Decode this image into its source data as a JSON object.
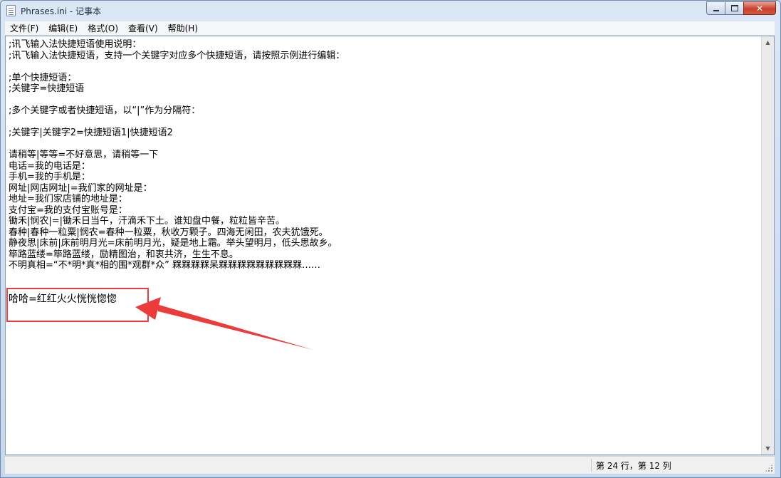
{
  "window": {
    "title": "Phrases.ini - 记事本",
    "close_label": "✕"
  },
  "menu": {
    "items": [
      "文件(F)",
      "编辑(E)",
      "格式(O)",
      "查看(V)",
      "帮助(H)"
    ]
  },
  "editor": {
    "lines": [
      ";讯飞输入法快捷短语使用说明：",
      ";讯飞输入法快捷短语，支持一个关键字对应多个快捷短语，请按照示例进行编辑：",
      "",
      ";单个快捷短语：",
      ";关键字=快捷短语",
      "",
      ";多个关键字或者快捷短语，以“|”作为分隔符：",
      "",
      ";关键字|关键字2=快捷短语1|快捷短语2",
      "",
      "请稍等|等等=不好意思，请稍等一下",
      "电话=我的电话是：",
      "手机=我的手机是：",
      "网址|网店网址|=我们家的网址是：",
      "地址=我们家店铺的地址是：",
      "支付宝=我的支付宝账号是：",
      "锄禾|悯农|=|锄禾日当午，汗滴禾下土。谁知盘中餐，粒粒皆辛苦。",
      "春种|春种一粒粟|悯农=春种一粒粟，秋收万颗子。四海无闲田，农夫犹饿死。",
      "静夜思|床前|床前明月光=床前明月光，疑是地上霜。举头望明月，低头思故乡。",
      "筚路蓝缕=筚路蓝缕，励精图治，和衷共济，生生不息。",
      "不明真相=“不*明*真*相的围*观群*众” 槑槑槑槑呆槑槑槑槑槑槑槑槑槑……",
      "",
      ""
    ],
    "highlight_line": "哈哈=红红火火恍恍惚惚"
  },
  "status": {
    "position": "第 24 行，第 12 列"
  },
  "colors": {
    "annotation": "#ec3b3b"
  }
}
